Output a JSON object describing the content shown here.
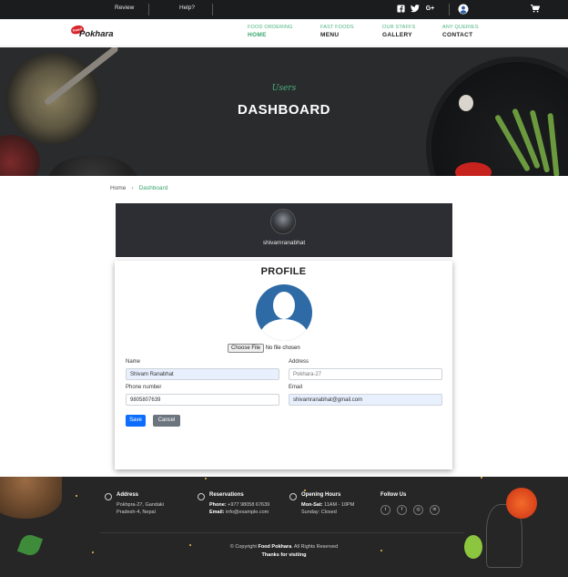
{
  "topbar": {
    "review": "Review",
    "help": "Help?",
    "icons": [
      "facebook-icon",
      "twitter-icon",
      "google-plus-icon",
      "user-icon",
      "cart-icon"
    ]
  },
  "brand": {
    "badge": "Food",
    "name": "Pokhara"
  },
  "nav": [
    {
      "sub": "FOOD ORDERING",
      "label": "HOME",
      "active": true
    },
    {
      "sub": "FAST FOODS",
      "label": "MENU"
    },
    {
      "sub": "OUR STAFFS",
      "label": "GALLERY"
    },
    {
      "sub": "ANY QUERIES",
      "label": "CONTACT"
    }
  ],
  "hero": {
    "script": "Users",
    "title": "DASHBOARD"
  },
  "breadcrumb": {
    "home": "Home",
    "current": "Dashboard"
  },
  "user": {
    "username": "shivamranabhat"
  },
  "profile": {
    "title": "PROFILE",
    "file_button": "Choose File",
    "file_status": "No file chosen",
    "fields": {
      "name_label": "Name",
      "name_value": "Shivam Ranabhat",
      "address_label": "Address",
      "address_placeholder": "Pokhara-27",
      "phone_label": "Phone number",
      "phone_value": "9805807639",
      "email_label": "Email",
      "email_value": "shivamranabhat@gmail.com"
    },
    "save": "Save",
    "cancel": "Cancel"
  },
  "footer": {
    "address": {
      "title": "Address",
      "line1": "Pokhpra-27, Gandaki",
      "line2": "Pradesh-4, Nepal"
    },
    "reservations": {
      "title": "Reservations",
      "phone_label": "Phone:",
      "phone": "+977 98058 67639",
      "email_label": "Email:",
      "email": "info@example.com"
    },
    "hours": {
      "title": "Opening Hours",
      "line1_label": "Mon-Sat:",
      "line1": "11AM - 10PM",
      "line2": "Sunday: Closed"
    },
    "follow": {
      "title": "Follow Us",
      "icons": [
        "twitter-icon",
        "facebook-icon",
        "instagram-icon",
        "linkedin-icon"
      ]
    },
    "copyright_prefix": "© Copyright",
    "copyright_brand": "Food Pokhara",
    "copyright_suffix": ". All Rights Reserved",
    "thanks": "Thanks for visiting"
  },
  "colors": {
    "accent": "#3aa56d",
    "primary": "#0d6efd",
    "secondary": "#6c757d",
    "dark": "#262626"
  }
}
